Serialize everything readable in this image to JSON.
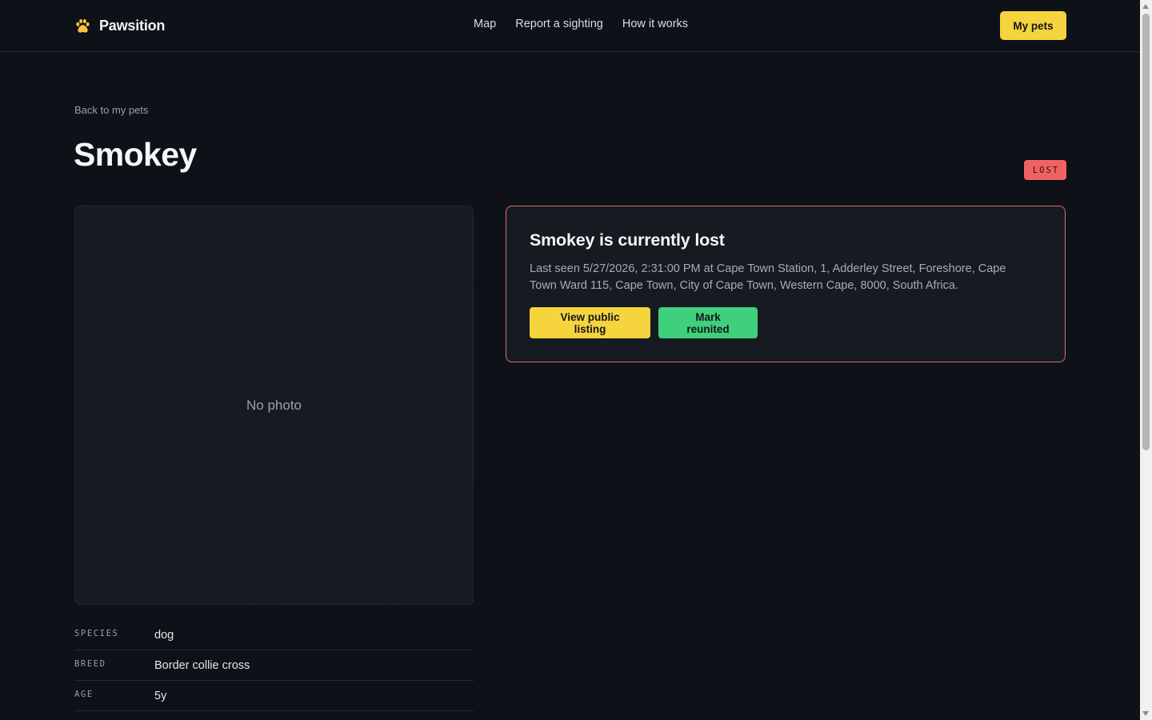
{
  "header": {
    "brand_name": "Pawsition",
    "brand_icon": "paw-icon",
    "nav": [
      {
        "label": "Map"
      },
      {
        "label": "Report a sighting"
      },
      {
        "label": "How it works"
      }
    ],
    "my_pets_label": "My pets"
  },
  "page": {
    "back_label": "Back to my pets",
    "title": "Smokey",
    "status": "LOST"
  },
  "photo": {
    "placeholder": "No photo"
  },
  "details": [
    {
      "label": "SPECIES",
      "value": "dog"
    },
    {
      "label": "BREED",
      "value": "Border collie cross"
    },
    {
      "label": "AGE",
      "value": "5y"
    }
  ],
  "alert": {
    "title": "Smokey is currently lost",
    "text": "Last seen 5/27/2026, 2:31:00 PM at Cape Town Station, 1, Adderley Street, Foreshore, Cape Town Ward 115, Cape Town, City of Cape Town, Western Cape, 8000, South Africa.",
    "view_listing_label": "View public listing",
    "mark_reunited_label": "Mark reunited"
  },
  "colors": {
    "background": "#0e1117",
    "accent_yellow": "#f6d43e",
    "accent_green": "#3ed07a",
    "lost_red": "#f06363"
  }
}
